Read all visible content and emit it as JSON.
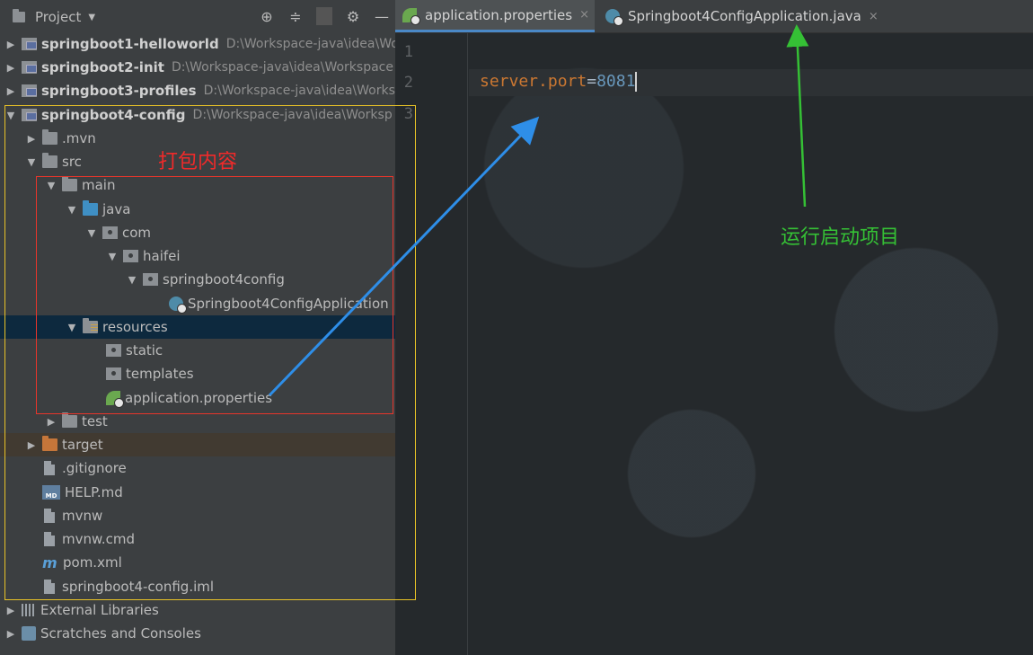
{
  "project_panel": {
    "title": "Project",
    "icons": [
      "target-icon",
      "collapse-icon",
      "gear-icon",
      "minimize-icon"
    ]
  },
  "tree": [
    {
      "name": "springboot1-helloworld",
      "path": "D:\\Workspace-java\\idea\\Wo",
      "bold": true
    },
    {
      "name": "springboot2-init",
      "path": "D:\\Workspace-java\\idea\\Workspace",
      "bold": true
    },
    {
      "name": "springboot3-profiles",
      "path": "D:\\Workspace-java\\idea\\Works",
      "bold": true
    },
    {
      "name": "springboot4-config",
      "path": "D:\\Workspace-java\\idea\\Worksp",
      "bold": true
    },
    {
      "name": ".mvn"
    },
    {
      "name": "src"
    },
    {
      "name": "main"
    },
    {
      "name": "java"
    },
    {
      "name": "com"
    },
    {
      "name": "haifei"
    },
    {
      "name": "springboot4config"
    },
    {
      "name": "Springboot4ConfigApplication"
    },
    {
      "name": "resources"
    },
    {
      "name": "static"
    },
    {
      "name": "templates"
    },
    {
      "name": "application.properties"
    },
    {
      "name": "test"
    },
    {
      "name": "target"
    },
    {
      "name": ".gitignore"
    },
    {
      "name": "HELP.md"
    },
    {
      "name": "mvnw"
    },
    {
      "name": "mvnw.cmd"
    },
    {
      "name": "pom.xml"
    },
    {
      "name": "springboot4-config.iml"
    },
    {
      "name": "External Libraries"
    },
    {
      "name": "Scratches and Consoles"
    }
  ],
  "md_icon_text": "MD",
  "maven_icon_text": "m",
  "tabs": [
    {
      "label": "application.properties",
      "close": "×"
    },
    {
      "label": "Springboot4ConfigApplication.java",
      "close": "×"
    }
  ],
  "editor": {
    "line_numbers": [
      "1",
      "2",
      "3"
    ],
    "code": {
      "key": "server.port",
      "eq": "=",
      "value": "8081"
    }
  },
  "annotations": {
    "pack_label": "打包内容",
    "run_label": "运行启动项目",
    "pack_color": "#f02a2a",
    "run_color": "#35c035",
    "arrow_blue": "#2e8ee8"
  }
}
